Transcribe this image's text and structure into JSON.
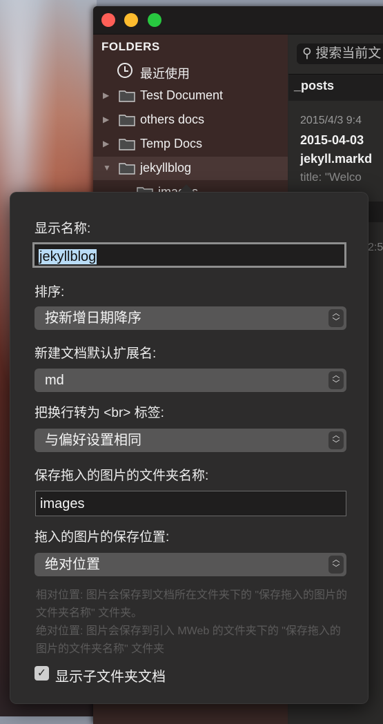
{
  "sidebar": {
    "title": "FOLDERS",
    "items": [
      {
        "label": "最近使用"
      },
      {
        "label": "Test Document"
      },
      {
        "label": "others docs"
      },
      {
        "label": "Temp Docs"
      },
      {
        "label": "jekyllblog"
      },
      {
        "label": "images"
      }
    ]
  },
  "list": {
    "search_placeholder": "搜索当前文",
    "section_header": "_posts",
    "doc1": {
      "date": "2015/4/3 9:4",
      "title": "2015-04-03",
      "subtitle": "jekyll.markd",
      "snippet": "title: \"Welco"
    },
    "doc2_date": "2:5"
  },
  "popover": {
    "display_name_label": "显示名称:",
    "display_name_value": "jekyllblog",
    "sort_label": "排序:",
    "sort_value": "按新增日期降序",
    "ext_label": "新建文档默认扩展名:",
    "ext_value": "md",
    "br_label": "把换行转为 <br> 标签:",
    "br_value": "与偏好设置相同",
    "img_folder_label": "保存拖入的图片的文件夹名称:",
    "img_folder_value": "images",
    "img_pos_label": "拖入的图片的保存位置:",
    "img_pos_value": "绝对位置",
    "help_text_1": "相对位置: 图片会保存到文档所在文件夹下的 \"保存拖入的图片的文件夹名称\" 文件夹。",
    "help_text_2": "绝对位置: 图片会保存到引入 MWeb 的文件夹下的 \"保存拖入的图片的文件夹名称\" 文件夹",
    "checkbox_label": "显示子文件夹文档",
    "checkbox_checked": true
  }
}
